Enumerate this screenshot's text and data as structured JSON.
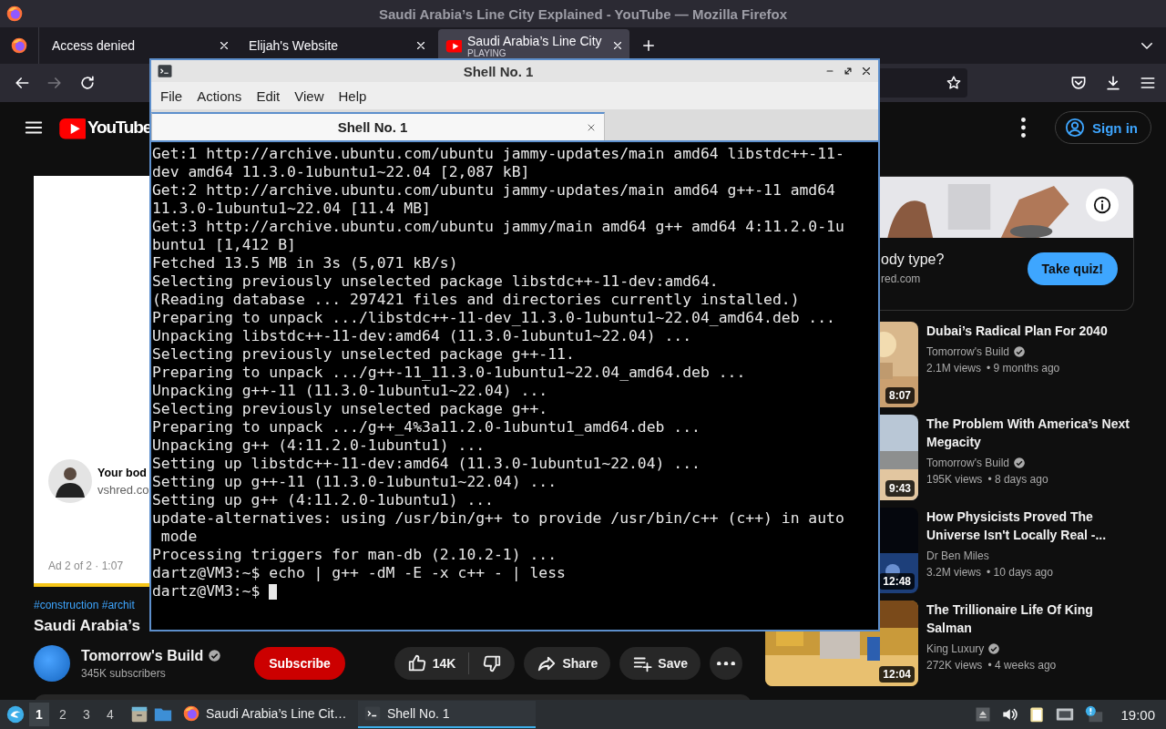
{
  "window": {
    "title": "Saudi Arabia’s Line City Explained - YouTube — Mozilla Firefox"
  },
  "browser_tabs": [
    {
      "title": "Access denied",
      "selected": false
    },
    {
      "title": "Elijah's Website",
      "selected": false
    },
    {
      "title": "Saudi Arabia’s Line City",
      "subtitle": "PLAYING",
      "selected": true
    }
  ],
  "nav_buttons": [
    {
      "kind": "back",
      "disabled": false
    },
    {
      "kind": "forward",
      "disabled": true
    },
    {
      "kind": "reload",
      "disabled": false
    }
  ],
  "youtube": {
    "logo": "YouTube",
    "sign_in": "Sign in",
    "player": {
      "ad_title": "Your bod",
      "ad_domain": "vshred.co",
      "ad_info": "Ad 2 of 2 · 1:07"
    },
    "video": {
      "tags": "#construction #archit",
      "title": "Saudi Arabia’s",
      "channel": "Tomorrow's Build",
      "verified": true,
      "subscribers": "345K subscribers",
      "subscribe": "Subscribe",
      "likes": "14K",
      "share": "Share",
      "save": "Save"
    },
    "sidebar_ad": {
      "title": "ody type?",
      "domain": "red.com",
      "button": "Take quiz!"
    },
    "recommendations": [
      {
        "title": "Dubai’s Radical Plan For 2040",
        "channel": "Tomorrow's Build",
        "verified": true,
        "views": "2.1M views",
        "age": "• 9 months ago",
        "duration": "8:07"
      },
      {
        "title": "The Problem With America’s Next Megacity",
        "channel": "Tomorrow's Build",
        "verified": true,
        "views": "195K views",
        "age": "• 8 days ago",
        "duration": "9:43"
      },
      {
        "title": "How Physicists Proved The Universe Isn't Locally Real -...",
        "channel": "Dr Ben Miles",
        "verified": false,
        "views": "3.2M views",
        "age": "• 10 days ago",
        "duration": "12:48"
      },
      {
        "title": "The Trillionaire Life Of King Salman",
        "channel": "King Luxury",
        "verified": true,
        "views": "272K views",
        "age": "• 4 weeks ago",
        "duration": "12:04"
      }
    ]
  },
  "terminal": {
    "title": "Shell No. 1",
    "menu": [
      "File",
      "Actions",
      "Edit",
      "View",
      "Help"
    ],
    "tabs": [
      {
        "label": "Shell No. 1",
        "selected": true
      }
    ],
    "lines": [
      "Get:1 http://archive.ubuntu.com/ubuntu jammy-updates/main amd64 libstdc++-11-",
      "dev amd64 11.3.0-1ubuntu1~22.04 [2,087 kB]",
      "Get:2 http://archive.ubuntu.com/ubuntu jammy-updates/main amd64 g++-11 amd64",
      "11.3.0-1ubuntu1~22.04 [11.4 MB]",
      "Get:3 http://archive.ubuntu.com/ubuntu jammy/main amd64 g++ amd64 4:11.2.0-1u",
      "buntu1 [1,412 B]",
      "Fetched 13.5 MB in 3s (5,071 kB/s)",
      "Selecting previously unselected package libstdc++-11-dev:amd64.",
      "(Reading database ... 297421 files and directories currently installed.)",
      "Preparing to unpack .../libstdc++-11-dev_11.3.0-1ubuntu1~22.04_amd64.deb ...",
      "Unpacking libstdc++-11-dev:amd64 (11.3.0-1ubuntu1~22.04) ...",
      "Selecting previously unselected package g++-11.",
      "Preparing to unpack .../g++-11_11.3.0-1ubuntu1~22.04_amd64.deb ...",
      "Unpacking g++-11 (11.3.0-1ubuntu1~22.04) ...",
      "Selecting previously unselected package g++.",
      "Preparing to unpack .../g++_4%3a11.2.0-1ubuntu1_amd64.deb ...",
      "Unpacking g++ (4:11.2.0-1ubuntu1) ...",
      "Setting up libstdc++-11-dev:amd64 (11.3.0-1ubuntu1~22.04) ...",
      "Setting up g++-11 (11.3.0-1ubuntu1~22.04) ...",
      "Setting up g++ (4:11.2.0-1ubuntu1) ...",
      "update-alternatives: using /usr/bin/g++ to provide /usr/bin/c++ (c++) in auto",
      " mode",
      "Processing triggers for man-db (2.10.2-1) ...",
      "dartz@VM3:~$ echo | g++ -dM -E -x c++ - | less",
      "dartz@VM3:~$"
    ],
    "cursor": true
  },
  "taskbar": {
    "workspaces": [
      {
        "label": "1",
        "selected": true
      },
      {
        "label": "2",
        "selected": false
      },
      {
        "label": "3",
        "selected": false
      },
      {
        "label": "4",
        "selected": false
      }
    ],
    "tasks": [
      {
        "kind": "firefox",
        "label": "Saudi Arabia’s Line Cit…",
        "active": false
      },
      {
        "kind": "terminal",
        "label": "Shell No. 1",
        "active": true
      }
    ],
    "clock": "19:00"
  }
}
